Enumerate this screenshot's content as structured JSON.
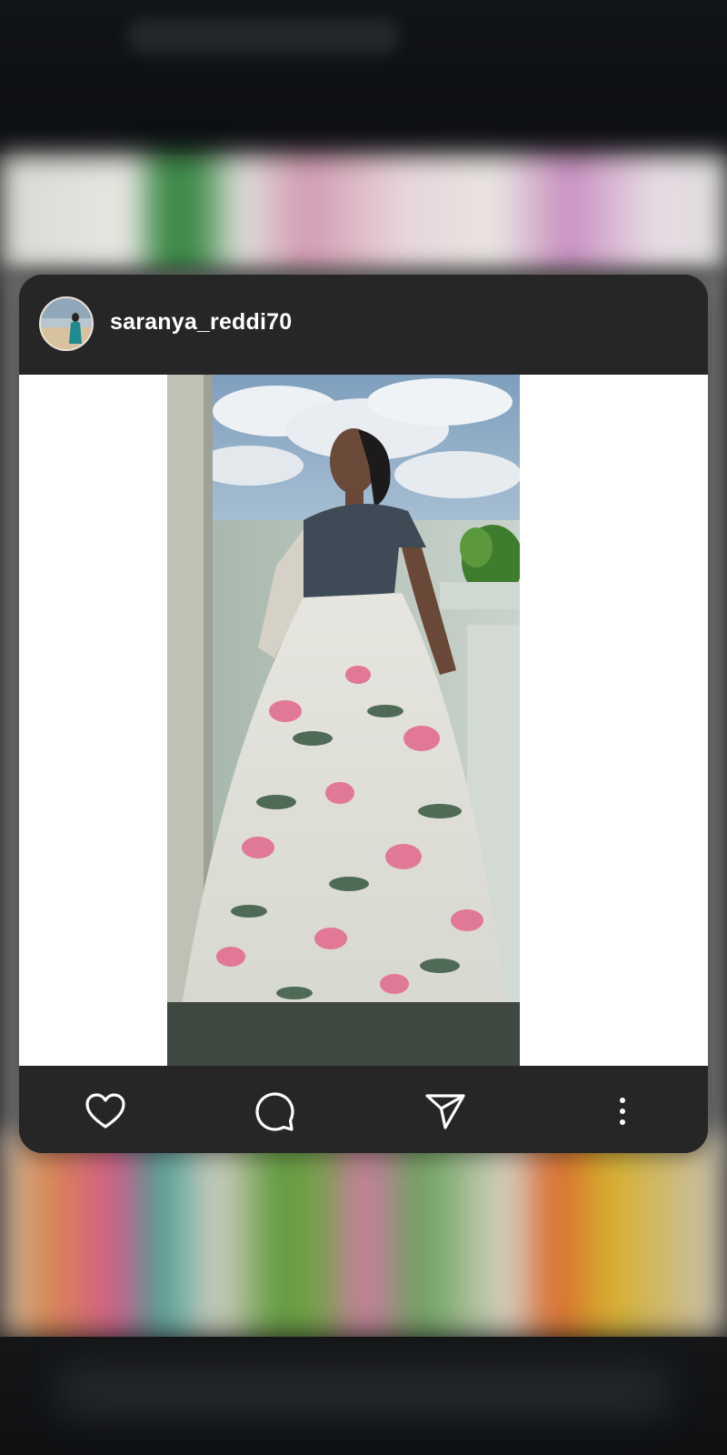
{
  "post": {
    "username": "saranya_reddi70"
  },
  "actions": {
    "like_icon": "heart-icon",
    "comment_icon": "comment-icon",
    "share_icon": "send-icon",
    "more_icon": "more-vertical-icon"
  },
  "colors": {
    "card_bg": "#262626",
    "media_bg": "#ffffff",
    "icon_color": "#ffffff"
  }
}
